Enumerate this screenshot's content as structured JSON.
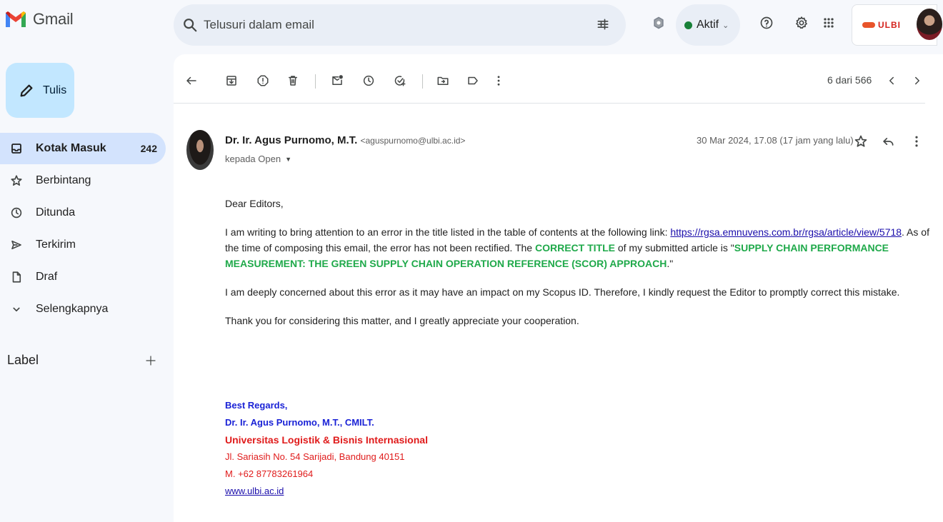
{
  "app": {
    "name": "Gmail"
  },
  "search": {
    "placeholder": "Telusuri dalam email"
  },
  "status": {
    "label": "Aktif"
  },
  "org": {
    "logo_text": "ULBI"
  },
  "compose": {
    "label": "Tulis"
  },
  "sidebar": {
    "items": [
      {
        "label": "Kotak Masuk",
        "count": "242",
        "icon": "inbox-icon",
        "active": true
      },
      {
        "label": "Berbintang",
        "icon": "star-icon"
      },
      {
        "label": "Ditunda",
        "icon": "clock-icon"
      },
      {
        "label": "Terkirim",
        "icon": "send-icon"
      },
      {
        "label": "Draf",
        "icon": "draft-icon"
      },
      {
        "label": "Selengkapnya",
        "icon": "chevron-down-icon"
      }
    ],
    "label_header": "Label"
  },
  "toolbar": {
    "pager": "6 dari 566"
  },
  "email": {
    "sender_name": "Dr. Ir. Agus Purnomo, M.T.",
    "sender_email": "<aguspurnomo@ulbi.ac.id>",
    "to": "kepada Open",
    "date": "30 Mar 2024, 17.08 (17 jam yang lalu)",
    "greeting": "Dear Editors,",
    "p1_a": "I am writing to bring attention to an error in the title listed in the table of contents at the following link: ",
    "p1_link": "https://rgsa.emnuvens.com.br/rgsa/article/view/5718",
    "p1_b": ". As of the time of composing this email, the error has not been rectified. The ",
    "p1_correct": "CORRECT TITLE",
    "p1_c": " of my submitted article is \"",
    "p1_title": "SUPPLY CHAIN PERFORMANCE MEASUREMENT: THE GREEN SUPPLY CHAIN OPERATION REFERENCE (SCOR) APPROACH",
    "p1_d": ".\"",
    "p2": "I am deeply concerned about this error as it may have an impact on my Scopus ID. Therefore, I kindly request the Editor to promptly correct this mistake.",
    "p3": "Thank you for considering this matter, and I greatly appreciate your cooperation."
  },
  "signature": {
    "regards": "Best Regards,",
    "name": "Dr. Ir. Agus Purnomo, M.T., CMILT.",
    "university": "Universitas Logistik & Bisnis Internasional",
    "address": "Jl. Sariasih No. 54 Sarijadi, Bandung 40151",
    "phone": "M. +62 87783261964",
    "website": "www.ulbi.ac.id"
  },
  "colors": {
    "compose_bg": "#c2e7ff",
    "active_bg": "#d3e3fd",
    "status_dot": "#188038",
    "green_text": "#1fa94a",
    "sig_blue": "#1a22d6",
    "sig_red": "#e01b1b"
  }
}
